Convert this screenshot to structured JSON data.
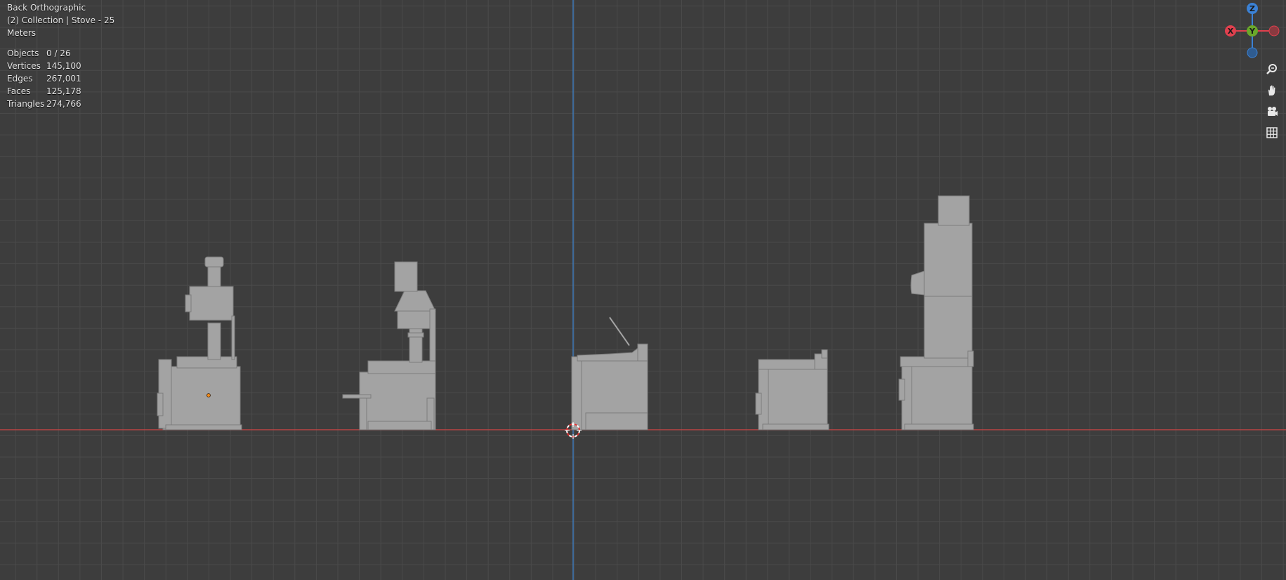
{
  "viewport": {
    "view_name": "Back Orthographic",
    "collection_info": "(2) Collection | Stove - 25",
    "units": "Meters"
  },
  "stats": [
    {
      "label": "Objects",
      "value": "0 / 26"
    },
    {
      "label": "Vertices",
      "value": "145,100"
    },
    {
      "label": "Edges",
      "value": "267,001"
    },
    {
      "label": "Faces",
      "value": "125,178"
    },
    {
      "label": "Triangles",
      "value": "274,766"
    }
  ],
  "gizmo": {
    "z_label": "Z",
    "x_label": "X",
    "y_label": "Y",
    "z_color": "#3b82d6",
    "x_color": "#e0404e",
    "y_color": "#6aa82a"
  },
  "nav_icons": [
    "zoom-icon",
    "hand-pan-icon",
    "camera-icon",
    "grid-view-icon"
  ],
  "colors": {
    "background": "#3d3d3d",
    "grid": "#4a4a4a",
    "x_axis": "#b84444",
    "z_axis": "#3f7ab8",
    "model": "#a3a3a3"
  }
}
